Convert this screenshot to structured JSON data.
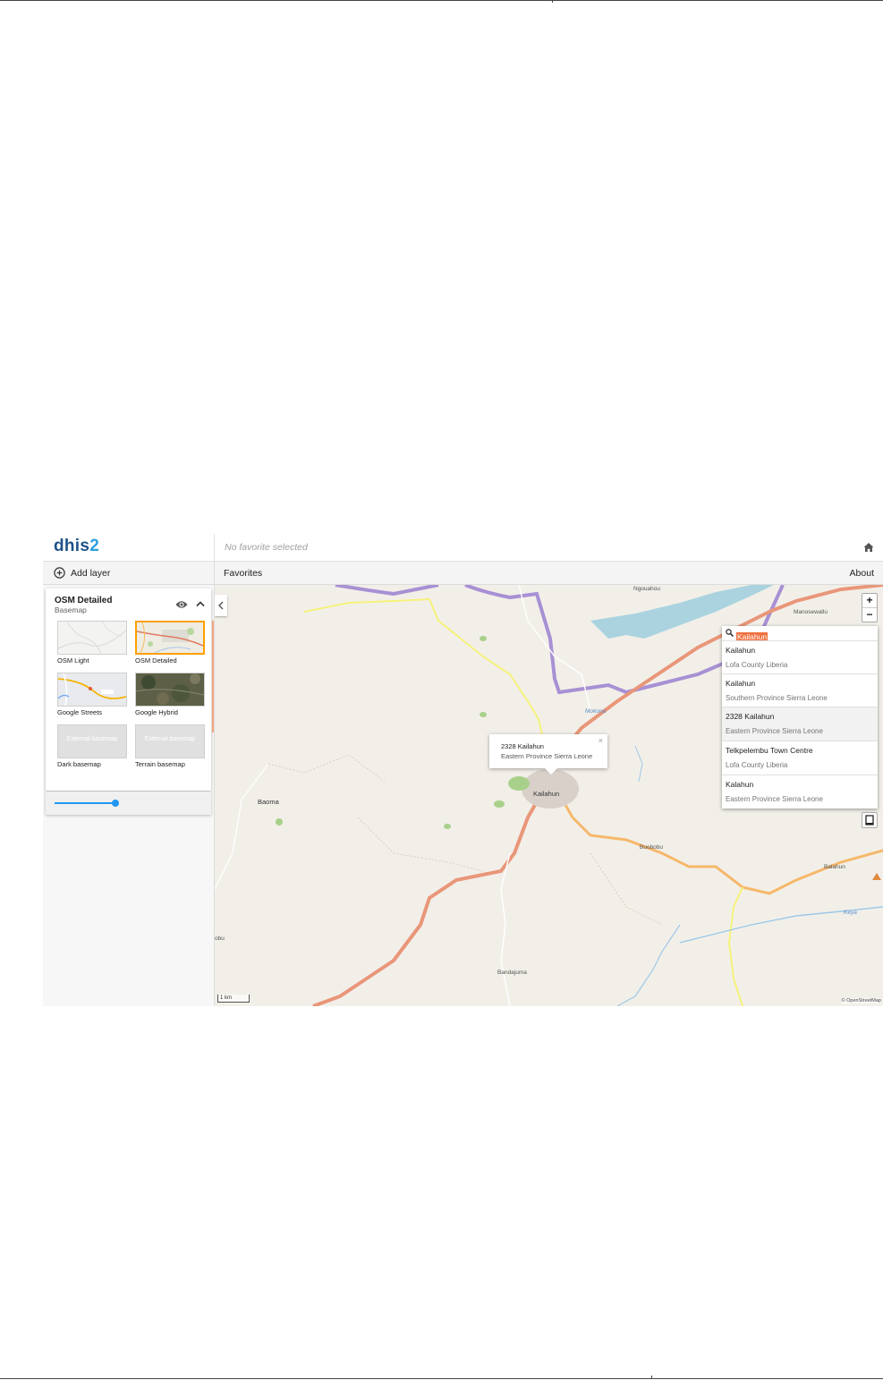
{
  "app": {
    "logo_main": "dhis",
    "logo_num": "2",
    "favorite_title": "No favorite selected"
  },
  "toolbar": {
    "add_layer": "Add layer",
    "favorites": "Favorites",
    "about": "About"
  },
  "layer": {
    "name": "OSM Detailed",
    "type": "Basemap",
    "opacity": 0.7,
    "basemaps": [
      {
        "label": "OSM Light",
        "selected": false
      },
      {
        "label": "OSM Detailed",
        "selected": true
      },
      {
        "label": "Google Streets",
        "selected": false
      },
      {
        "label": "Google Hybrid",
        "selected": false
      },
      {
        "label": "Dark basemap",
        "placeholder": "External basemap",
        "selected": false
      },
      {
        "label": "Terrain basemap",
        "placeholder": "External basemap",
        "selected": false
      }
    ]
  },
  "map": {
    "zoom_in": "+",
    "zoom_out": "−",
    "labels": {
      "ngouahou": "Ngouahou",
      "manosewallu": "Manosewallu",
      "mokona": "Mokona",
      "baoma": "Baoma",
      "kailahun": "Kailahun",
      "buobobu": "Buobobu",
      "balahun": "Balahun",
      "bandajuma": "Bandajuma",
      "obu": "obu",
      "river": "Keya"
    },
    "scale": "1 km",
    "attribution": "© OpenStreetMap",
    "popup": {
      "name": "2328 Kailahun",
      "region": "Eastern Province Sierra Leone",
      "close": "×"
    },
    "search": {
      "query": "Kailahun",
      "results": [
        {
          "name": "Kailahun",
          "region": "Lofa County Liberia"
        },
        {
          "name": "Kailahun",
          "region": "Southern Province Sierra Leone"
        },
        {
          "name": "2328 Kailahun",
          "region": "Eastern Province Sierra Leone"
        },
        {
          "name": "Telkpelembu Town Centre",
          "region": "Lofa County Liberia"
        },
        {
          "name": "Kalahun",
          "region": "Eastern Province Sierra Leone"
        }
      ]
    }
  },
  "colors": {
    "brand": "#1d5288",
    "accent": "#2196f3",
    "selection": "#ffa000",
    "highlight": "#f07040",
    "border_line": "#9b7fd0",
    "main_road": "#e99679"
  }
}
